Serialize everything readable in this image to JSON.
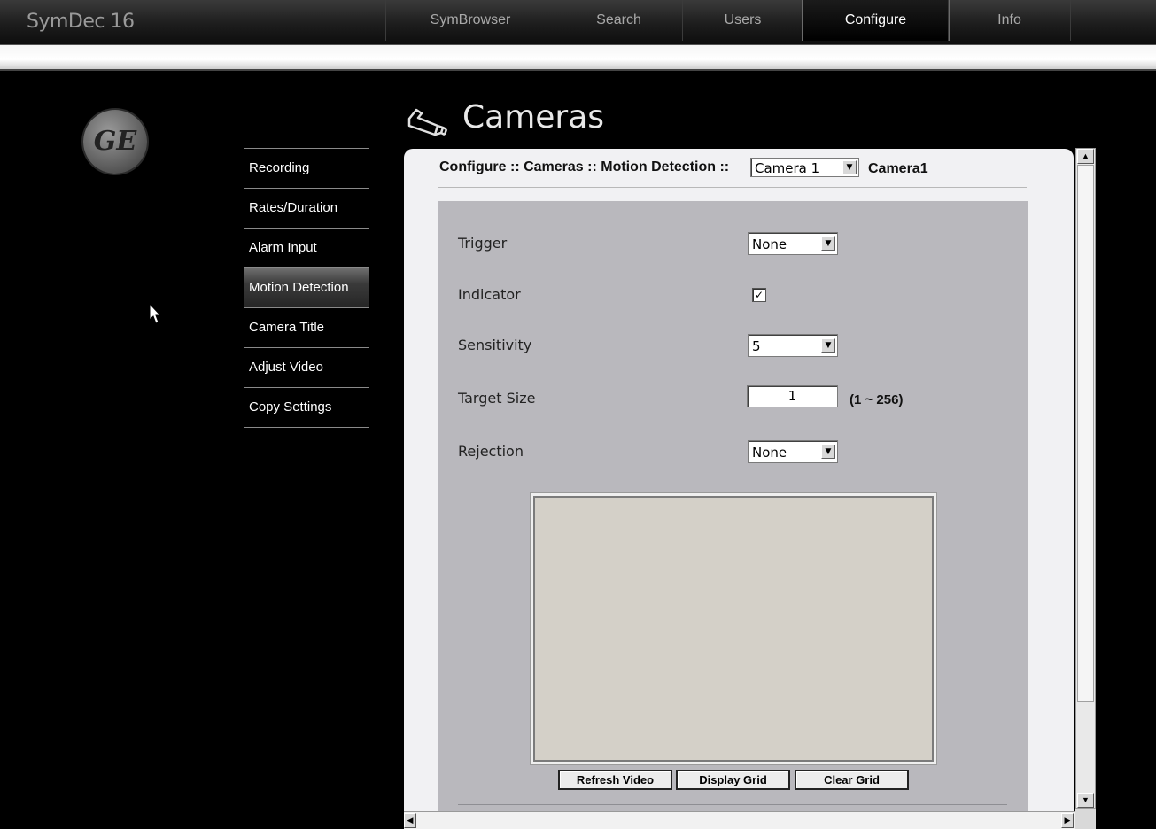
{
  "app": {
    "title": "SymDec 16"
  },
  "tabs": [
    {
      "label": "SymBrowser",
      "active": false
    },
    {
      "label": "Search",
      "active": false
    },
    {
      "label": "Users",
      "active": false
    },
    {
      "label": "Configure",
      "active": true
    },
    {
      "label": "Info",
      "active": false
    }
  ],
  "logo": {
    "text": "GE"
  },
  "page": {
    "title": "Cameras"
  },
  "nav": {
    "items": [
      {
        "label": "Recording"
      },
      {
        "label": "Rates/Duration"
      },
      {
        "label": "Alarm Input"
      },
      {
        "label": "Motion Detection",
        "active": true
      },
      {
        "label": "Camera Title"
      },
      {
        "label": "Adjust Video"
      },
      {
        "label": "Copy Settings"
      }
    ]
  },
  "breadcrumb": {
    "text": "Configure :: Cameras :: Motion Detection ::",
    "camera_select": "Camera 1",
    "camera_name": "Camera1"
  },
  "form": {
    "trigger": {
      "label": "Trigger",
      "value": "None"
    },
    "indicator": {
      "label": "Indicator",
      "checked": true,
      "check_mark": "✓"
    },
    "sensitivity": {
      "label": "Sensitivity",
      "value": "5"
    },
    "target_size": {
      "label": "Target Size",
      "value": "1",
      "range": "(1 ~ 256)"
    },
    "rejection": {
      "label": "Rejection",
      "value": "None"
    }
  },
  "buttons": {
    "refresh": "Refresh Video",
    "display_grid": "Display Grid",
    "clear_grid": "Clear Grid"
  },
  "icons": {
    "dropdown": "▼",
    "scroll_up": "▲",
    "scroll_down": "▼",
    "scroll_left": "◀",
    "scroll_right": "▶"
  }
}
